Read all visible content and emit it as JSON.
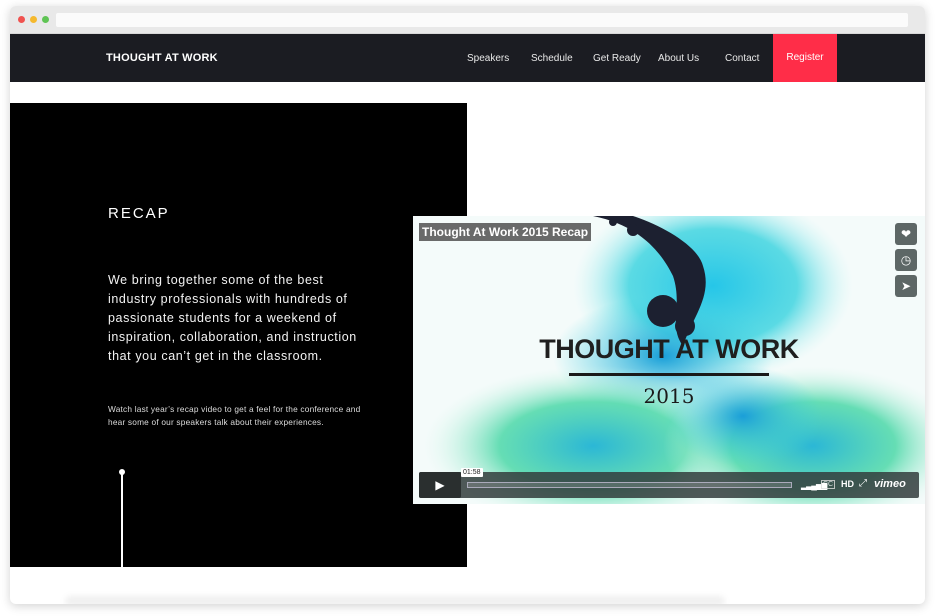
{
  "nav": {
    "brand": "THOUGHT AT WORK",
    "items": [
      {
        "label": "Speakers"
      },
      {
        "label": "Schedule"
      },
      {
        "label": "Get Ready"
      },
      {
        "label": "About Us"
      },
      {
        "label": "Contact"
      }
    ],
    "register_label": "Register"
  },
  "recap": {
    "title": "RECAP",
    "lead": "We bring together some of the best industry professionals with hundreds of passionate students for a weekend of inspiration, collaboration, and instruction that you can’t get in the classroom.",
    "small": "Watch last year’s recap video to get a feel for the conference and hear some of our speakers talk about their experiences."
  },
  "video": {
    "title": "Thought At Work 2015 Recap",
    "brand_title": "THOUGHT AT WORK",
    "brand_year": "2015",
    "time": "01:58",
    "hd_label": "HD",
    "provider_label": "vimeo",
    "icons": {
      "like": "heart-icon",
      "watch_later": "clock-icon",
      "share": "paper-plane-icon",
      "play": "play-icon"
    }
  },
  "colors": {
    "nav_bg": "#1b1c22",
    "register_bg": "#ff2d48",
    "panel_bg": "#000000",
    "ink_cyan": "#3fd4e0",
    "ink_green": "#4cd8a8",
    "ink_dark": "#1c2030"
  }
}
